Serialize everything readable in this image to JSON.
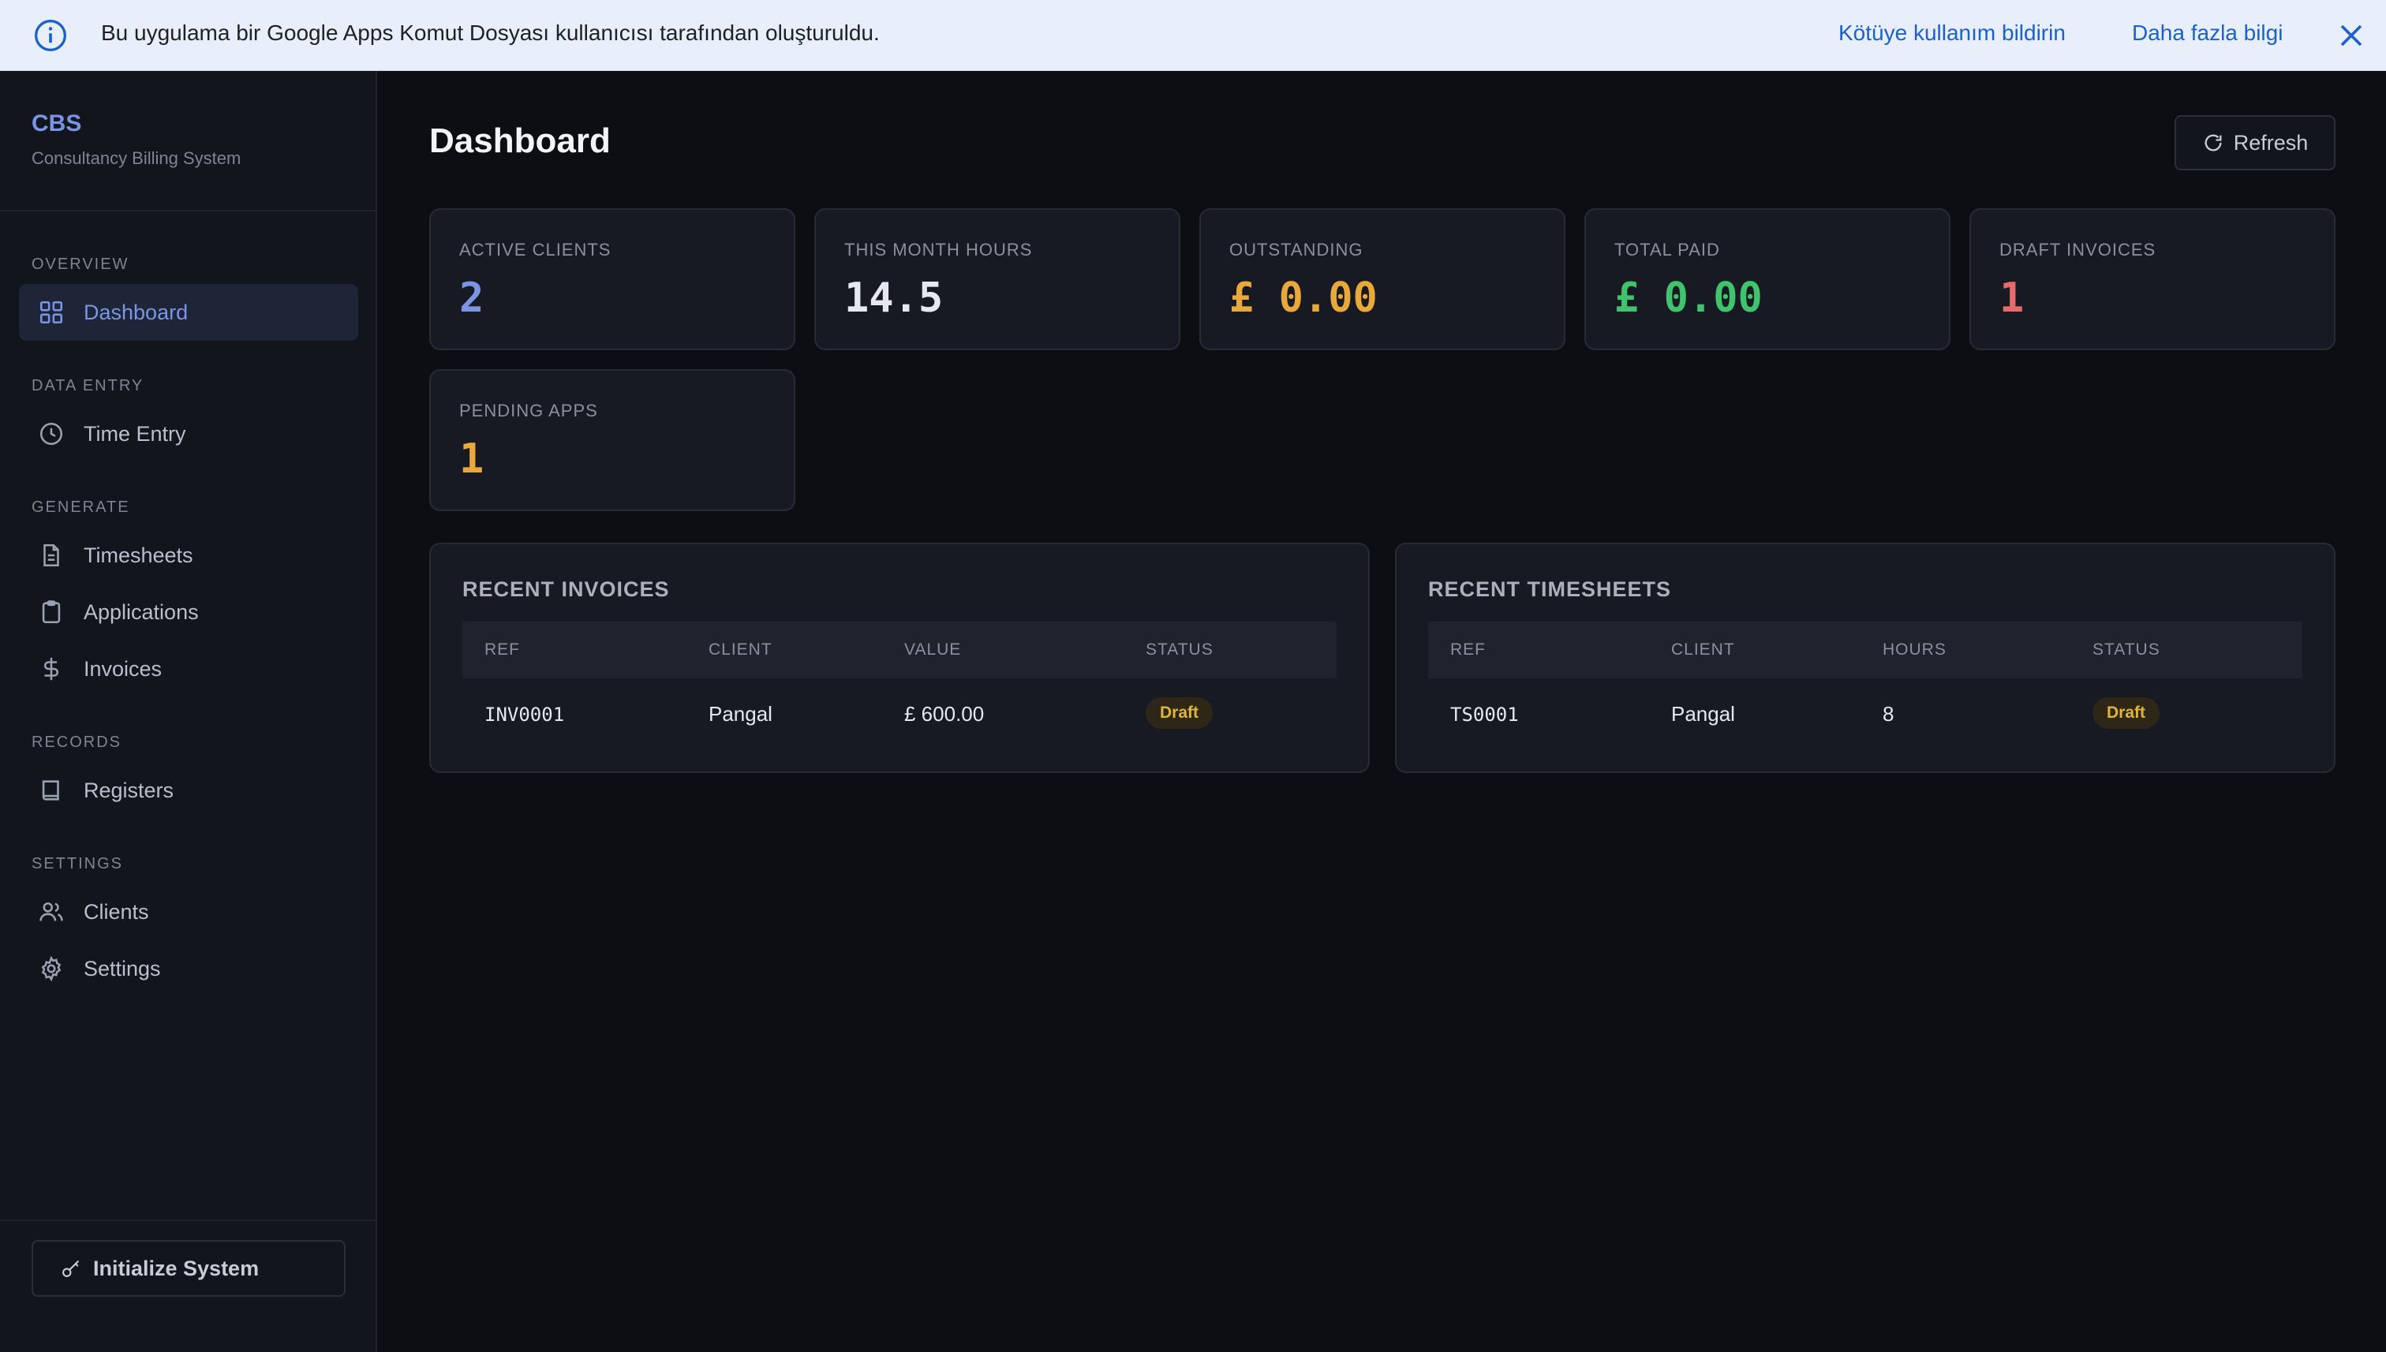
{
  "banner": {
    "message": "Bu uygulama bir Google Apps Komut Dosyası kullanıcısı tarafından oluşturuldu.",
    "report_abuse": "Kötüye kullanım bildirin",
    "learn_more": "Daha fazla bilgi",
    "info_icon": "info-icon",
    "close_icon": "close-icon"
  },
  "brand": {
    "name": "CBS",
    "subtitle": "Consultancy Billing System"
  },
  "sidebar": {
    "sections": [
      {
        "label": "OVERVIEW",
        "items": [
          {
            "label": "Dashboard",
            "icon": "grid-icon",
            "active": true
          }
        ]
      },
      {
        "label": "DATA ENTRY",
        "items": [
          {
            "label": "Time Entry",
            "icon": "clock-icon"
          }
        ]
      },
      {
        "label": "GENERATE",
        "items": [
          {
            "label": "Timesheets",
            "icon": "document-icon"
          },
          {
            "label": "Applications",
            "icon": "clipboard-icon"
          },
          {
            "label": "Invoices",
            "icon": "dollar-icon"
          }
        ]
      },
      {
        "label": "RECORDS",
        "items": [
          {
            "label": "Registers",
            "icon": "book-icon"
          }
        ]
      },
      {
        "label": "SETTINGS",
        "items": [
          {
            "label": "Clients",
            "icon": "users-icon"
          },
          {
            "label": "Settings",
            "icon": "gear-icon"
          }
        ]
      }
    ],
    "init_button": "Initialize System"
  },
  "main": {
    "title": "Dashboard",
    "refresh_label": "Refresh",
    "stats": [
      {
        "label": "ACTIVE CLIENTS",
        "value": "2",
        "color": "#7b95e6"
      },
      {
        "label": "THIS MONTH HOURS",
        "value": "14.5",
        "color": "#e6e8ee"
      },
      {
        "label": "OUTSTANDING",
        "value": "£ 0.00",
        "color": "#e8a93a"
      },
      {
        "label": "TOTAL PAID",
        "value": "£ 0.00",
        "color": "#3fc46d"
      },
      {
        "label": "DRAFT INVOICES",
        "value": "1",
        "color": "#e66a6a"
      },
      {
        "label": "PENDING APPS",
        "value": "1",
        "color": "#e8a93a"
      }
    ],
    "recent_invoices": {
      "title": "RECENT INVOICES",
      "columns": [
        "REF",
        "CLIENT",
        "VALUE",
        "STATUS"
      ],
      "rows": [
        {
          "ref": "INV0001",
          "client": "Pangal",
          "value": "£ 600.00",
          "status": "Draft"
        }
      ]
    },
    "recent_timesheets": {
      "title": "RECENT TIMESHEETS",
      "columns": [
        "REF",
        "CLIENT",
        "HOURS",
        "STATUS"
      ],
      "rows": [
        {
          "ref": "TS0001",
          "client": "Pangal",
          "hours": "8",
          "status": "Draft"
        }
      ]
    }
  },
  "colors": {
    "accent": "#7b95e6",
    "draft_badge": "#e0b43c",
    "link": "#1a62c9"
  }
}
